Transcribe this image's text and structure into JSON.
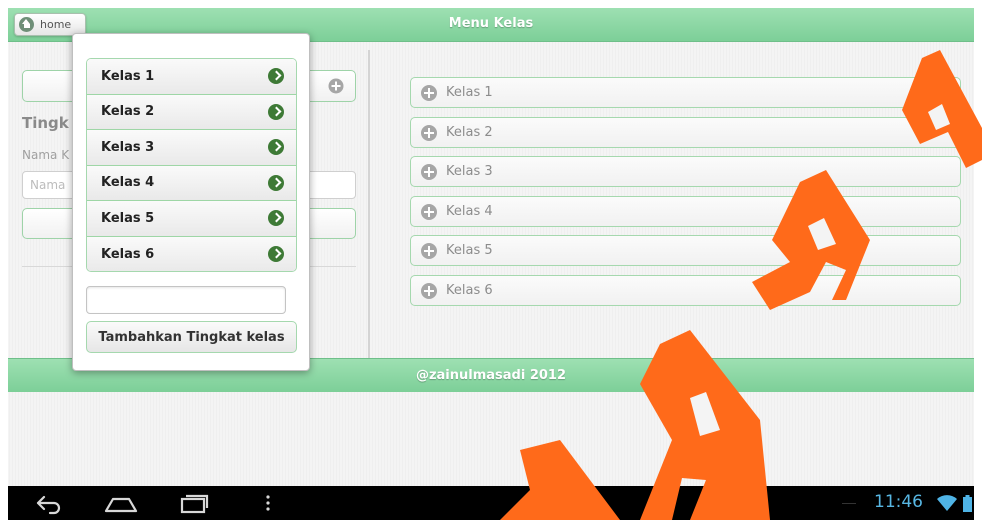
{
  "header": {
    "title": "Menu Kelas",
    "home_label": "home"
  },
  "background_form": {
    "title_fragment": "Tingk",
    "name_label_fragment": "Nama K",
    "name_placeholder_fragment": "Nama"
  },
  "popup": {
    "items": [
      {
        "label": "Kelas 1"
      },
      {
        "label": "Kelas 2"
      },
      {
        "label": "Kelas 3"
      },
      {
        "label": "Kelas 4"
      },
      {
        "label": "Kelas 5"
      },
      {
        "label": "Kelas 6"
      }
    ],
    "input_value": "",
    "add_button_label": "Tambahkan Tingkat kelas"
  },
  "kelas_list": [
    {
      "label": "Kelas 1"
    },
    {
      "label": "Kelas 2"
    },
    {
      "label": "Kelas 3"
    },
    {
      "label": "Kelas 4"
    },
    {
      "label": "Kelas 5"
    },
    {
      "label": "Kelas 6"
    }
  ],
  "footer": {
    "text": "@zainulmasadi 2012"
  },
  "status_bar": {
    "time": "11:46"
  },
  "colors": {
    "accent_green": "#7dcf98",
    "arrow_green": "#3e7a36",
    "watermark": "#ff6a1a",
    "clock_blue": "#58b7e3"
  },
  "icons": [
    "home-icon",
    "arrow-right-icon",
    "plus-icon",
    "back-icon",
    "home-nav-icon",
    "recents-icon",
    "menu-icon",
    "wifi-icon",
    "battery-icon"
  ],
  "watermark_text": "RABAYA"
}
